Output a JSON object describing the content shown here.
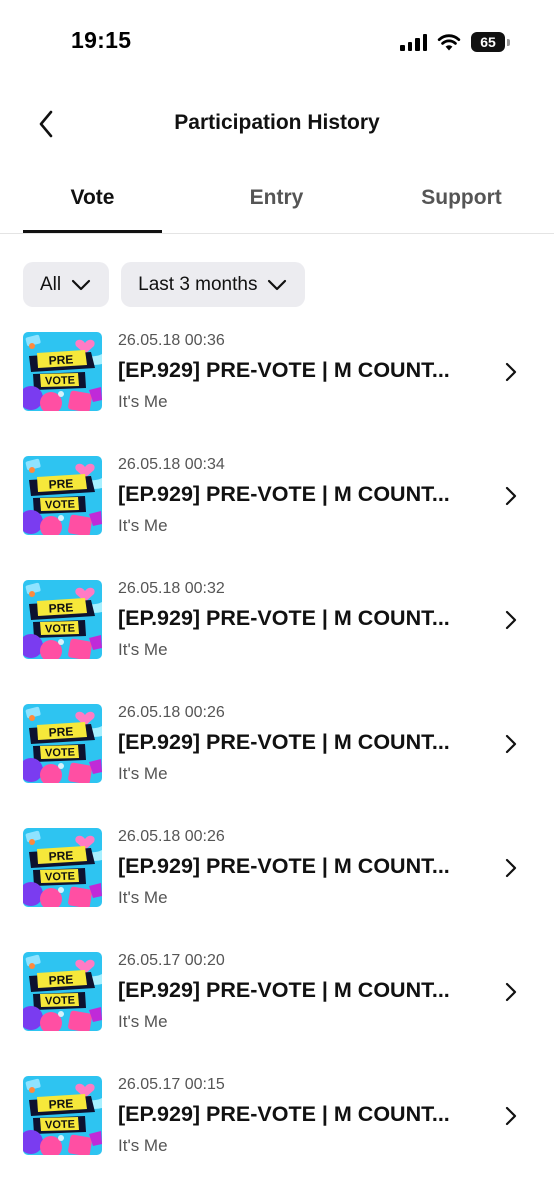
{
  "status_bar": {
    "time": "19:15",
    "battery": "65",
    "icons": [
      "signal-icon",
      "wifi-icon",
      "battery-icon"
    ]
  },
  "header": {
    "title": "Participation History",
    "back_icon": "chevron-left-icon"
  },
  "tabs": [
    {
      "label": "Vote",
      "active": true
    },
    {
      "label": "Entry",
      "active": false
    },
    {
      "label": "Support",
      "active": false
    }
  ],
  "filters": {
    "type": "All",
    "period": "Last 3 months",
    "icon": "chevron-down-icon"
  },
  "items": [
    {
      "date": "26.05.18 00:36",
      "title": "[EP.929] PRE-VOTE | M COUNT...",
      "subtitle": "It's Me",
      "thumb_text": [
        "PRE",
        "VOTE"
      ]
    },
    {
      "date": "26.05.18 00:34",
      "title": "[EP.929] PRE-VOTE | M COUNT...",
      "subtitle": "It's Me",
      "thumb_text": [
        "PRE",
        "VOTE"
      ]
    },
    {
      "date": "26.05.18 00:32",
      "title": "[EP.929] PRE-VOTE | M COUNT...",
      "subtitle": "It's Me",
      "thumb_text": [
        "PRE",
        "VOTE"
      ]
    },
    {
      "date": "26.05.18 00:26",
      "title": "[EP.929] PRE-VOTE | M COUNT...",
      "subtitle": "It's Me",
      "thumb_text": [
        "PRE",
        "VOTE"
      ]
    },
    {
      "date": "26.05.18 00:26",
      "title": "[EP.929] PRE-VOTE | M COUNT...",
      "subtitle": "It's Me",
      "thumb_text": [
        "PRE",
        "VOTE"
      ]
    },
    {
      "date": "26.05.17 00:20",
      "title": "[EP.929] PRE-VOTE | M COUNT...",
      "subtitle": "It's Me",
      "thumb_text": [
        "PRE",
        "VOTE"
      ]
    },
    {
      "date": "26.05.17 00:15",
      "title": "[EP.929] PRE-VOTE | M COUNT...",
      "subtitle": "It's Me",
      "thumb_text": [
        "PRE",
        "VOTE"
      ]
    }
  ],
  "colors": {
    "text_primary": "#111111",
    "text_secondary": "#555555",
    "chip_background": "#ececf0",
    "divider": "#e4e4e4",
    "thumb_background": "#2ec4f1",
    "thumb_banner": "#f6e83a",
    "thumb_pink": "#ff4fa3",
    "thumb_purple": "#7a3cf0"
  }
}
